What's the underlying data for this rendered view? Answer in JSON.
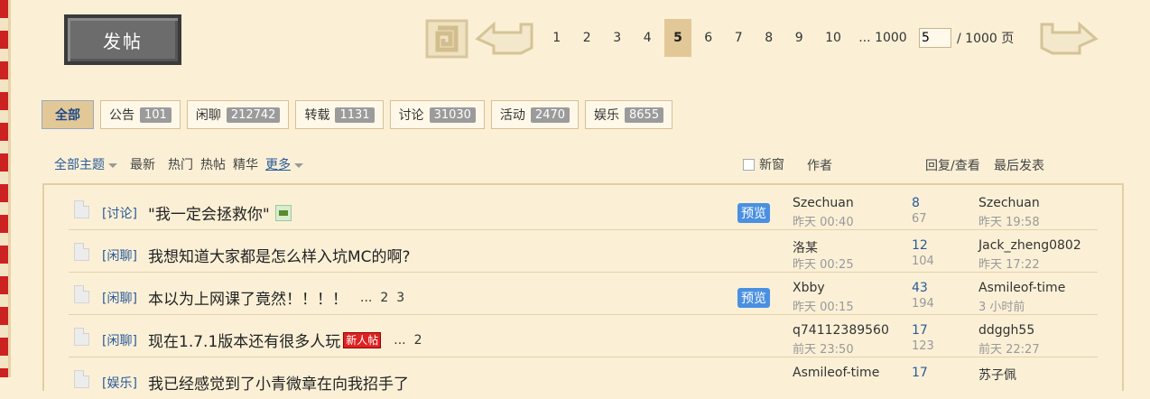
{
  "post_button": {
    "label": "发帖"
  },
  "pager": {
    "pages": [
      "1",
      "2",
      "3",
      "4",
      "5",
      "6",
      "7",
      "8",
      "9",
      "10",
      "... 1000"
    ],
    "current": "5",
    "jump_value": "5",
    "total": "/ 1000 页"
  },
  "tabs": [
    {
      "label": "全部",
      "count": ""
    },
    {
      "label": "公告",
      "count": "101"
    },
    {
      "label": "闲聊",
      "count": "212742"
    },
    {
      "label": "转载",
      "count": "1131"
    },
    {
      "label": "讨论",
      "count": "31030"
    },
    {
      "label": "活动",
      "count": "2470"
    },
    {
      "label": "娱乐",
      "count": "8655"
    }
  ],
  "filters": {
    "all_topics": "全部主题",
    "latest": "最新",
    "hot": "热门",
    "hot_posts": "热帖",
    "featured": "精华",
    "more": "更多",
    "new_window": "新窗",
    "author": "作者",
    "reply_view": "回复/查看",
    "last_post": "最后发表"
  },
  "threads": [
    {
      "cat": "[讨论]",
      "title": "\"我一定会拯救你\"",
      "pages": [],
      "has_image": true,
      "new": false,
      "preview": "预览",
      "author": "Szechuan",
      "atime": "昨天 00:40",
      "replies": "8",
      "views": "67",
      "last_user": "Szechuan",
      "last_time": "昨天 19:58"
    },
    {
      "cat": "[闲聊]",
      "title": "我想知道大家都是怎么样入坑MC的啊?",
      "pages": [],
      "has_image": false,
      "new": false,
      "preview": "",
      "author": "洛某",
      "atime": "昨天 00:25",
      "replies": "12",
      "views": "104",
      "last_user": "Jack_zheng0802",
      "last_time": "昨天 17:22"
    },
    {
      "cat": "[闲聊]",
      "title": "本以为上网课了竟然！！！！",
      "pages": [
        "...",
        "2",
        "3"
      ],
      "has_image": false,
      "new": false,
      "preview": "预览",
      "author": "Xbby",
      "atime": "昨天 00:15",
      "replies": "43",
      "views": "194",
      "last_user": "Asmileof-time",
      "last_time": "3 小时前"
    },
    {
      "cat": "[闲聊]",
      "title": "现在1.7.1版本还有很多人玩",
      "pages": [
        "...",
        "2"
      ],
      "has_image": false,
      "new": true,
      "new_label": "新人帖",
      "preview": "",
      "author": "q74112389560",
      "atime": "前天 23:50",
      "replies": "17",
      "views": "123",
      "last_user": "ddggh55",
      "last_time": "前天 22:27"
    },
    {
      "cat": "[娱乐]",
      "title": "我已经感觉到了小青微章在向我招手了",
      "pages": [],
      "has_image": false,
      "new": false,
      "preview": "",
      "author": "Asmileof-time",
      "atime": "",
      "replies": "17",
      "views": "",
      "last_user": "苏子佩",
      "last_time": ""
    }
  ],
  "colors": {
    "accent": "#e3c897",
    "link": "#2a5a9a",
    "background": "#fbf0d6",
    "preview": "#4a90e2"
  }
}
